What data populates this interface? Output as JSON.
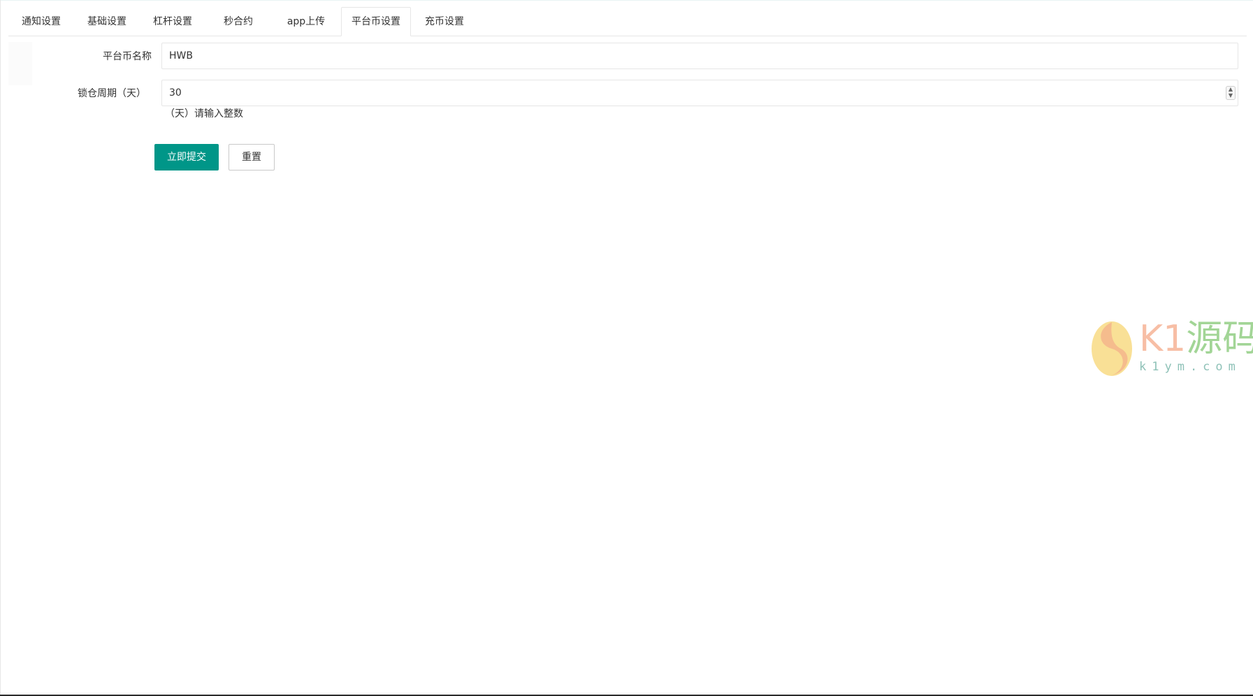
{
  "tabs": [
    {
      "label": "通知设置",
      "active": false
    },
    {
      "label": "基础设置",
      "active": false
    },
    {
      "label": "杠杆设置",
      "active": false
    },
    {
      "label": "秒合约",
      "active": false
    },
    {
      "label": "app上传",
      "active": false
    },
    {
      "label": "平台币设置",
      "active": true
    },
    {
      "label": "充币设置",
      "active": false
    }
  ],
  "form": {
    "coin_name": {
      "label": "平台币名称",
      "value": "HWB"
    },
    "lock_period": {
      "label": "锁仓周期（天）",
      "value": "30",
      "hint": "（天）请输入整数"
    },
    "submit_label": "立即提交",
    "reset_label": "重置"
  },
  "watermark": {
    "brand_prefix": "K1",
    "brand_suffix": "源码",
    "domain": "k1ym.com"
  },
  "colors": {
    "primary": "#009688",
    "border": "#e6e6e6"
  }
}
